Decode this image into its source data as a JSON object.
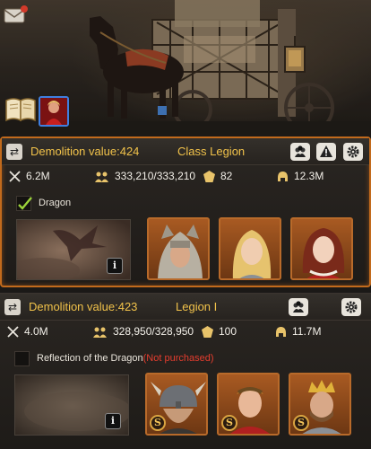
{
  "scene": {
    "corner_icon": "envelope-icon",
    "book_icon": "book-icon",
    "hero_thumb": "hero-portrait-icon"
  },
  "legions": [
    {
      "demolition_label": "Demolition value:424",
      "legion_name": "Class Legion",
      "header_icons": [
        "team-icon",
        "warning-icon",
        "gear-icon"
      ],
      "stats": {
        "attack": "6.2M",
        "troops": "333,210/333,210",
        "level": "82",
        "power": "12.3M"
      },
      "dragon_checked": true,
      "dragon_label": "Dragon",
      "dragon_status": "",
      "info_label": "i",
      "heroes": [
        {
          "name": "hero-wolf-hood",
          "badge": ""
        },
        {
          "name": "hero-blonde-knight",
          "badge": ""
        },
        {
          "name": "hero-red-queen",
          "badge": ""
        }
      ]
    },
    {
      "demolition_label": "Demolition value:423",
      "legion_name": "Legion I",
      "header_icons": [
        "team-icon",
        "gear-icon"
      ],
      "stats": {
        "attack": "4.0M",
        "troops": "328,950/328,950",
        "level": "100",
        "power": "11.7M"
      },
      "dragon_checked": false,
      "dragon_label": "Reflection of the Dragon",
      "dragon_status": "(Not purchased)",
      "info_label": "i",
      "heroes": [
        {
          "name": "hero-viking-helmet",
          "badge": "S"
        },
        {
          "name": "hero-laurel-emperor",
          "badge": "S"
        },
        {
          "name": "hero-crowned-king",
          "badge": "S"
        }
      ]
    }
  ],
  "colors": {
    "accent_gold": "#f1c24a",
    "selected_border": "#c26a1c",
    "not_purchased": "#e53d2e"
  }
}
